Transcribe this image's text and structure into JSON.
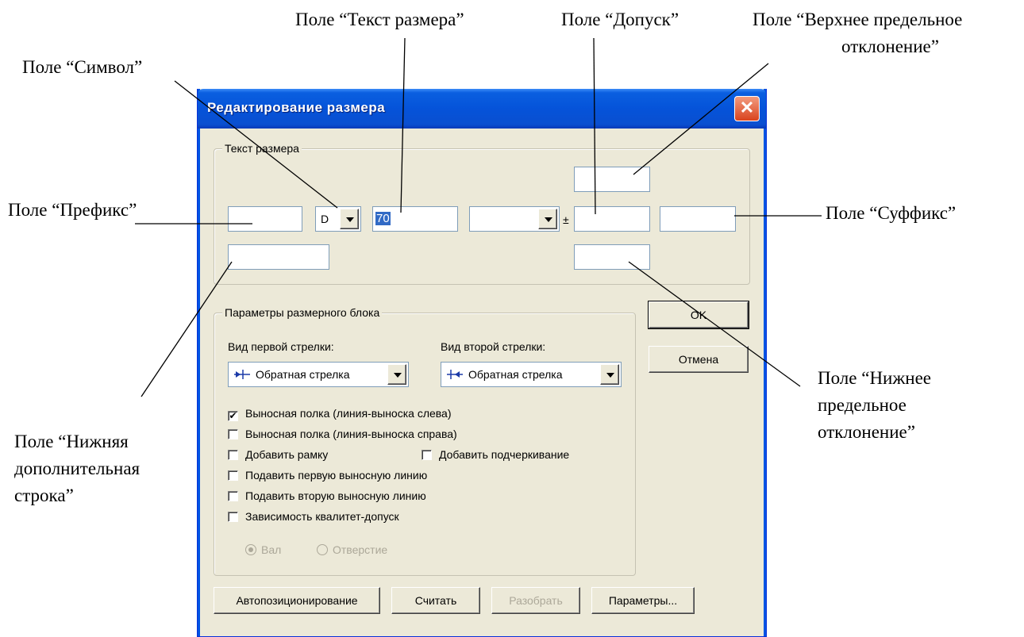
{
  "callouts": {
    "symbol": "Поле “Символ”",
    "dim_text": "Поле “Текст размера”",
    "tolerance": "Поле “Допуск”",
    "upper_line1": "Поле “Верхнее предельное",
    "upper_line2": "отклонение”",
    "prefix": "Поле “Префикс”",
    "suffix": "Поле “Суффикс”",
    "lower_dev_line1": "Поле “Нижнее",
    "lower_dev_line2": "предельное",
    "lower_dev_line3": "отклонение”",
    "bottom_line1": "Поле “Нижняя",
    "bottom_line2": "дополнительная",
    "bottom_line3": "строка”"
  },
  "dialog": {
    "title": "Редактирование размера",
    "close_glyph": "✕",
    "text_group": {
      "label": "Текст размера",
      "symbol_value": "D",
      "dim_value": "70",
      "plus_minus": "±"
    },
    "block_group": {
      "label": "Параметры размерного блока",
      "first_arrow_label": "Вид первой стрелки:",
      "second_arrow_label": "Вид второй стрелки:",
      "first_arrow_value": "Обратная стрелка",
      "second_arrow_value": "Обратная стрелка",
      "checkboxes": [
        {
          "label": "Выносная полка (линия-выноска слева)",
          "checked": true
        },
        {
          "label": "Выносная полка (линия-выноска справа)",
          "checked": false
        },
        {
          "label": "Добавить рамку",
          "checked": false
        },
        {
          "label": "Добавить подчеркивание",
          "checked": false
        },
        {
          "label": "Подавить первую выносную линию",
          "checked": false
        },
        {
          "label": "Подавить вторую выносную линию",
          "checked": false
        },
        {
          "label": "Зависимость квалитет-допуск",
          "checked": false
        }
      ],
      "radio_shaft": "Вал",
      "radio_hole": "Отверстие"
    },
    "buttons": {
      "ok": "OK",
      "cancel": "Отмена",
      "autopos": "Автопозиционирование",
      "read": "Считать",
      "parse": "Разобрать",
      "params": "Параметры..."
    }
  }
}
